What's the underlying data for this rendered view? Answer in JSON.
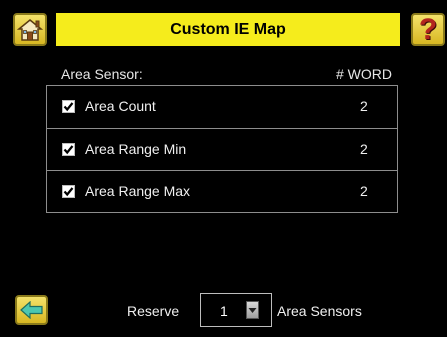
{
  "header": {
    "title": "Custom IE Map",
    "home_icon": "home-icon",
    "help_icon": "help-icon",
    "help_glyph": "?"
  },
  "columns": {
    "left": "Area Sensor:",
    "right": "# WORD"
  },
  "rows": [
    {
      "label": "Area Count",
      "value": "2",
      "checked": true
    },
    {
      "label": "Area Range Min",
      "value": "2",
      "checked": true
    },
    {
      "label": "Area Range Max",
      "value": "2",
      "checked": true
    }
  ],
  "footer": {
    "back_icon": "back-arrow-icon",
    "reserve_label": "Reserve",
    "reserve_value": "1",
    "unit_label": "Area Sensors",
    "dropdown_icon": "dropdown-arrow-icon"
  },
  "colors": {
    "title_bar": "#f5ec1c",
    "button_yellow": "#e8cf3a",
    "background": "#000000",
    "table_border": "#8d8d8d"
  }
}
